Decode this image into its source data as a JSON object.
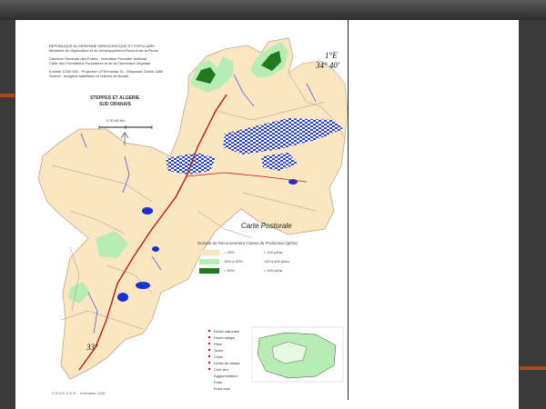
{
  "map": {
    "header_lines": [
      "REPUBLIQUE ALGERIENNE DEMOCRATIQUE ET POPULAIRE",
      "Ministere de l'Agriculture et du Developpement Rural et de la Peche",
      "Direction Generale des Forets - Inventaire Forestier National",
      "Carte des Formations Forestieres et de la Couverture Vegetale",
      "Echelle 1/200 000 - Projection UTM fuseau 31 - Ellipsoide Clarke 1880",
      "Source : Imagerie satellitaire et releves de terrain"
    ],
    "region_title": "STEPPES ET ALGERIE",
    "region_subtitle": "SUD ORANAIS",
    "scale_label": "0 20 40 Km",
    "coord_lon": "1°E",
    "coord_lat_north": "34° 40'",
    "coord_lat_south": "33°",
    "inset_title": "Carte Postorale",
    "legend": {
      "title": "Densite du Recouvrement    Classe de Production (pl/ha)",
      "rows": [
        {
          "label": "< 25%",
          "value": "< 100 pl/ha",
          "color": "#fbe6c2"
        },
        {
          "label": "25% a 50%",
          "value": "100 a 400 pl/ha",
          "color": "#b7ecb4"
        },
        {
          "label": "> 50%",
          "value": "> 400 pl/ha",
          "color": "#1f7a1f"
        }
      ]
    },
    "symbol_legend": [
      "Route nationale",
      "Route wilaya",
      "Piste",
      "Oued",
      "Chott",
      "Limite de wilaya",
      "Chef-lieu",
      "Agglomeration",
      "Puits",
      "Point cote"
    ],
    "footer": "© B.N.E.D.E.R. - Inventaire 2008",
    "colors": {
      "steppe": "#fbe6c2",
      "forest_light": "#b7ecb4",
      "forest_dense": "#1f7a1f",
      "water": "#1530d8",
      "road": "#c21818",
      "track": "#b7a98a"
    }
  }
}
